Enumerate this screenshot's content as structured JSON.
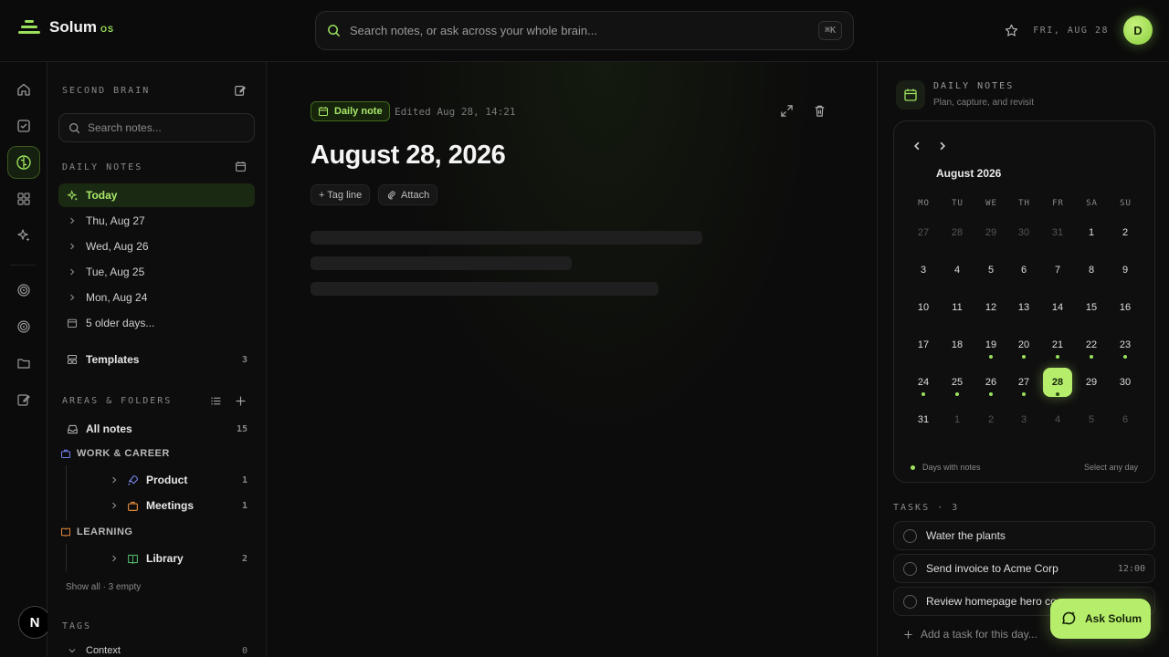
{
  "app": {
    "name": "Solum",
    "suffix": "OS"
  },
  "search": {
    "placeholder": "Search notes, or ask across your whole brain...",
    "shortcut": "⌘K"
  },
  "topbar": {
    "date": "FRI, AUG 28",
    "avatar": "D"
  },
  "sidebar": {
    "section_title": "SECOND BRAIN",
    "search_placeholder": "Search notes...",
    "daily_title": "DAILY NOTES",
    "daily_items": [
      {
        "label": "Today",
        "icon": "sparkle-icon"
      },
      {
        "label": "Thu, Aug 27"
      },
      {
        "label": "Wed, Aug 26"
      },
      {
        "label": "Tue, Aug 25"
      },
      {
        "label": "Mon, Aug 24"
      },
      {
        "label": "5 older days..."
      }
    ],
    "templates": {
      "label": "Templates",
      "count": "3"
    },
    "areas_title": "AREAS & FOLDERS",
    "all_notes": {
      "label": "All notes",
      "count": "15"
    },
    "work_head": "WORK & CAREER",
    "product": {
      "label": "Product",
      "count": "1"
    },
    "meetings": {
      "label": "Meetings",
      "count": "1"
    },
    "learning_head": "LEARNING",
    "library": {
      "label": "Library",
      "count": "2"
    },
    "show_all": "Show all · 3 empty",
    "tags_title": "TAGS",
    "context": {
      "label": "Context",
      "count": "0"
    }
  },
  "note": {
    "chip": "Daily note",
    "edited": "Edited Aug 28, 14:21",
    "title": "August 28, 2026",
    "tag_line": "+ Tag line",
    "attach": "Attach"
  },
  "right": {
    "title": "DAILY NOTES",
    "subtitle": "Plan, capture, and revisit",
    "month": "August 2026",
    "weekdays": [
      "MO",
      "TU",
      "WE",
      "TH",
      "FR",
      "SA",
      "SU"
    ],
    "days": [
      {
        "d": "27",
        "m": true
      },
      {
        "d": "28",
        "m": true
      },
      {
        "d": "29",
        "m": true
      },
      {
        "d": "30",
        "m": true
      },
      {
        "d": "31",
        "m": true
      },
      {
        "d": "1"
      },
      {
        "d": "2"
      },
      {
        "d": "3"
      },
      {
        "d": "4"
      },
      {
        "d": "5"
      },
      {
        "d": "6"
      },
      {
        "d": "7"
      },
      {
        "d": "8"
      },
      {
        "d": "9"
      },
      {
        "d": "10"
      },
      {
        "d": "11"
      },
      {
        "d": "12"
      },
      {
        "d": "13"
      },
      {
        "d": "14"
      },
      {
        "d": "15"
      },
      {
        "d": "16"
      },
      {
        "d": "17"
      },
      {
        "d": "18"
      },
      {
        "d": "19",
        "dot": true
      },
      {
        "d": "20",
        "dot": true
      },
      {
        "d": "21",
        "dot": true
      },
      {
        "d": "22",
        "dot": true
      },
      {
        "d": "23",
        "dot": true
      },
      {
        "d": "24",
        "dot": true
      },
      {
        "d": "25",
        "dot": true
      },
      {
        "d": "26",
        "dot": true
      },
      {
        "d": "27",
        "dot": true
      },
      {
        "d": "28",
        "dot": true,
        "sel": true
      },
      {
        "d": "29"
      },
      {
        "d": "30"
      },
      {
        "d": "31"
      },
      {
        "d": "1",
        "m": true
      },
      {
        "d": "2",
        "m": true
      },
      {
        "d": "3",
        "m": true
      },
      {
        "d": "4",
        "m": true
      },
      {
        "d": "5",
        "m": true
      },
      {
        "d": "6",
        "m": true
      }
    ],
    "legend": "Days with notes",
    "select_hint": "Select any day",
    "tasks_title": "TASKS · 3",
    "tasks": [
      {
        "label": "Water the plants",
        "time": ""
      },
      {
        "label": "Send invoice to Acme Corp",
        "time": "12:00"
      },
      {
        "label": "Review homepage hero co",
        "time": ""
      }
    ],
    "add_task": "Add a task for this day..."
  },
  "ask": {
    "label": "Ask Solum"
  },
  "colors": {
    "accent": "#b6ee6c",
    "accent_dark": "#9be15d"
  }
}
